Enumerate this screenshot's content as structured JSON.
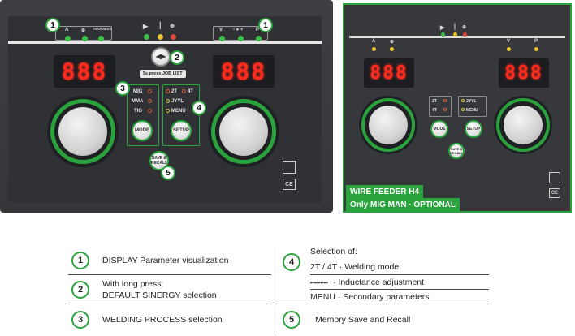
{
  "main_panel": {
    "left_group_labels": [
      "A",
      "⊕",
      "THICKNESS"
    ],
    "right_group_labels": [
      "V",
      "P"
    ],
    "right_group_sub": "- ● +",
    "left_display": "888",
    "right_display": "888",
    "job_label": "5s press JOB LIST",
    "process_options": [
      "MIG",
      "MMA",
      "TIG"
    ],
    "mode_options_left": [
      "2T",
      "JYYL",
      "MENU"
    ],
    "mode_options_right": [
      "4T"
    ],
    "mode_button": "MODE",
    "setup_button": "SETUP",
    "save_button": "SAVE & RECALL",
    "ce_mark": "CE",
    "badges": [
      "1",
      "1",
      "2",
      "3",
      "4",
      "5"
    ]
  },
  "wire_feeder": {
    "labels": [
      "A",
      "⊕",
      "V",
      "P"
    ],
    "left_display": "888",
    "right_display": "888",
    "opts_left": [
      "2T",
      "4T"
    ],
    "opts_right": [
      "JYYL",
      "MENU"
    ],
    "mode_button": "MODE",
    "setup_button": "SETUP",
    "save_button": "SAVE & RECALL",
    "caption_line1": "WIRE FEEDER H4",
    "caption_line2": "Only MIG MAN · OPTIONAL",
    "ce_mark": "CE"
  },
  "legend": {
    "items": [
      {
        "num": "1",
        "text": "DISPLAY Parameter visualization"
      },
      {
        "num": "2",
        "line1": "With long press:",
        "line2": "DEFAULT SINERGY selection"
      },
      {
        "num": "3",
        "text": "WELDING PROCESS selection"
      },
      {
        "num": "4",
        "title": "Selection of:",
        "line1": "2T / 4T · Welding mode",
        "line2_icon": "⎓⎓⎓",
        "line2": "· Inductance adjustment",
        "line3": "MENU · Secondary parameters"
      },
      {
        "num": "5",
        "text": "Memory Save and Recall"
      }
    ]
  },
  "colors": {
    "accent_green": "#2aa33c",
    "display_red": "#ff2b1e",
    "panel_dark": "#34363a"
  }
}
